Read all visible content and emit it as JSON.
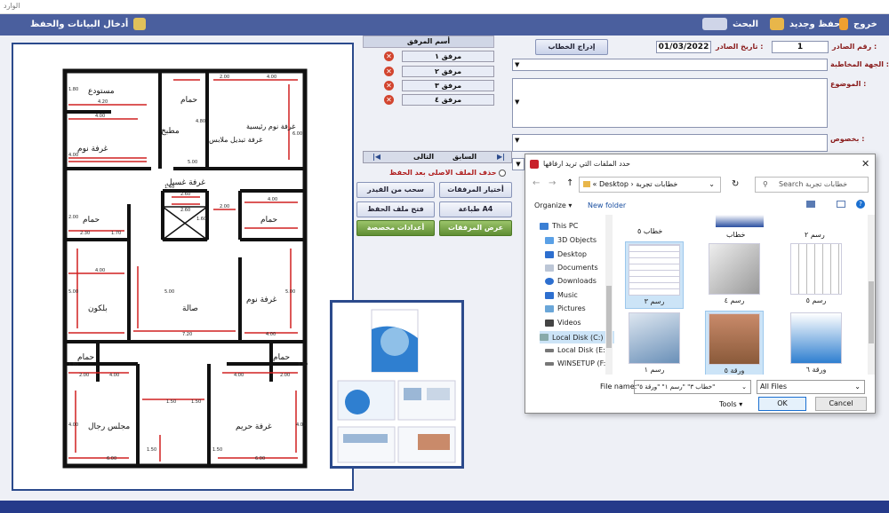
{
  "window": {
    "title": "الوارد"
  },
  "topbar": {
    "exit": "خروج",
    "save_new": "حفظ وجديد",
    "search": "البحث",
    "data_entry": "أدخال البيانات والحفظ"
  },
  "attachments": {
    "header": "أسم المرفق",
    "items": [
      "مرفق ١",
      "مرفق ٢",
      "مرفق ٣",
      "مرفق ٤"
    ],
    "nav": {
      "prev": "السابق",
      "next": "التالى"
    },
    "delete_original": "حذف الملف الاصلى بعد الحفظ",
    "buttons": {
      "choose": "أختيار المرفقات",
      "scan": "سحب من الفيدر",
      "print_a4": "طباعة A4",
      "open_folder": "فتح ملف الحفظ",
      "show": "عرض المرفقات",
      "custom": "أعدادات مخصصة"
    }
  },
  "form": {
    "number_label": "رقم الصادر :",
    "number_value": "1",
    "date_label": "تاريخ الصادر :",
    "date_value": "01/03/2022",
    "insert_letter": "إدراج الخطاب",
    "party_label": "الجهة المخاطبة :",
    "subject_label": "الموضوع :",
    "regarding_label": "بخصوص :"
  },
  "blueprint": {
    "rooms": [
      "مستودع",
      "مطبخ",
      "حمام",
      "غرفة تبديل ملابس",
      "غرفة نوم رئيسية",
      "غرفة نوم",
      "غرفة غسيل",
      "حمام",
      "حمام",
      "بلكون",
      "صالة",
      "غرفة نوم",
      "حمام",
      "حمام",
      "مجلس رجال",
      "غرفة حريم"
    ],
    "dims": [
      "4.20",
      "2.00",
      "4.00",
      "1.80",
      "4.00",
      "4.80",
      "6.00",
      "4.00",
      "5.00",
      "1.40",
      "2.60",
      "2.60",
      "2.00",
      "4.00",
      "1.60",
      "2.00",
      "2.30",
      "1.70",
      "4.00",
      "5.00",
      "5.00",
      "5.00",
      "7.20",
      "4.00",
      "1.80",
      "2.00",
      "4.00",
      "4.00",
      "2.00",
      "1.80",
      "1.50",
      "1.50",
      "4.00",
      "4.00",
      "1.50",
      "6.00",
      "1.50",
      "6.00"
    ]
  },
  "dialog": {
    "title": "حدد الملفات التي تريد ارفاقها",
    "address": [
      "Desktop",
      "خطابات تجربة"
    ],
    "search_placeholder": "Search خطابات تجربة",
    "organize": "Organize",
    "new_folder": "New folder",
    "tree": [
      "This PC",
      "3D Objects",
      "Desktop",
      "Documents",
      "Downloads",
      "Music",
      "Pictures",
      "Videos",
      "Local Disk (C:)",
      "Local Disk (E:)",
      "WINSETUP (F:)"
    ],
    "top_files": [
      "خطاب ٥",
      "خطاب",
      "رسم ٢"
    ],
    "files": [
      "رسم ٣",
      "رسم ٤",
      "رسم ٥",
      "رسم ١",
      "ورقة ٥",
      "ورقة ٦"
    ],
    "filename_label": "File name:",
    "filename_value": "\"خطاب ٣\" \"رسم ١\" \"ورقة ٥\"",
    "filter": "All Files",
    "tools": "Tools",
    "ok": "OK",
    "cancel": "Cancel"
  }
}
